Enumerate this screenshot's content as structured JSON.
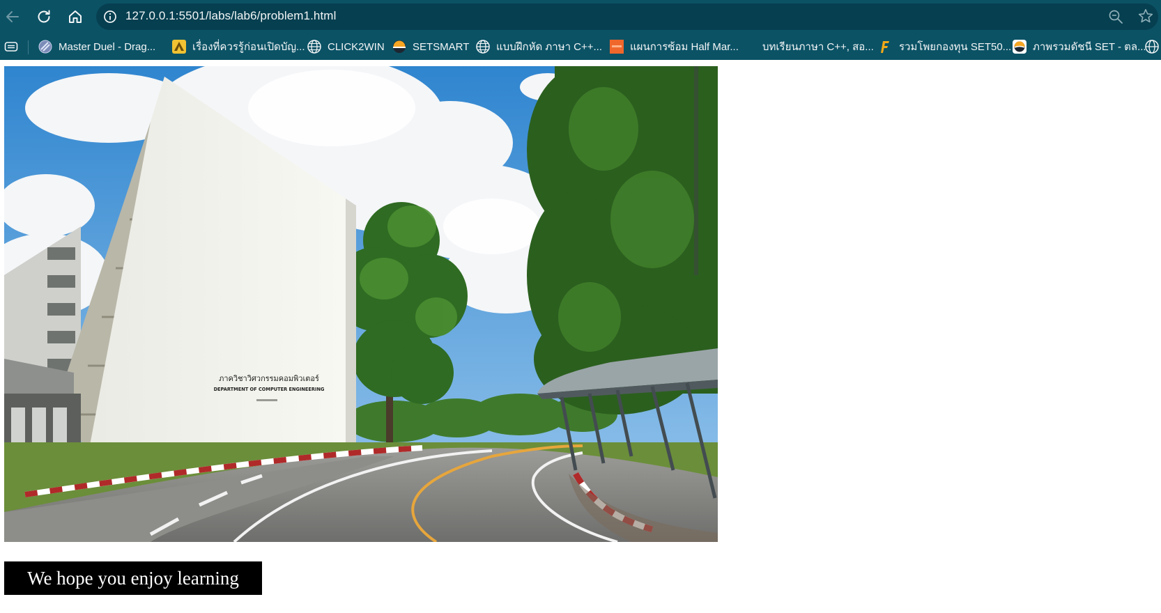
{
  "browser": {
    "url": "127.0.0.1:5501/labs/lab6/problem1.html",
    "toolbar_color": "#0b5265",
    "address_bar_color": "#063f50",
    "icons": [
      "back-arrow-icon",
      "reload-icon",
      "home-icon",
      "site-info-icon",
      "zoom-icon",
      "favorite-star-icon"
    ]
  },
  "bookmarks": [
    {
      "label": "Master Duel - Drag...",
      "icon": "master-duel-icon"
    },
    {
      "label": "เรื่องที่ควรรู้ก่อนเปิดบัญ...",
      "icon": "bank-logo-icon"
    },
    {
      "label": "CLICK2WIN",
      "icon": "globe-icon"
    },
    {
      "label": "SETSMART",
      "icon": "setsmart-icon"
    },
    {
      "label": "แบบฝึกหัด ภาษา C++...",
      "icon": "globe-icon"
    },
    {
      "label": "แผนการซ้อม Half Mar...",
      "icon": "orange-site-icon"
    },
    {
      "label": "บทเรียนภาษา C++, สอ...",
      "icon": "none"
    },
    {
      "label": "รวมโพยกองทุน SET50...",
      "icon": "f-logo-icon"
    },
    {
      "label": "ภาพรวมดัชนี SET - ตล...",
      "icon": "set-logo-icon"
    }
  ],
  "page": {
    "hero_sign_thai": "ภาควิชาวิศวกรรมคอมพิวเตอร์",
    "hero_sign_english": "DEPARTMENT OF COMPUTER ENGINEERING",
    "banner_text": "We hope you enjoy learning",
    "banner_bg": "#000000",
    "banner_fg": "#ffffff"
  }
}
